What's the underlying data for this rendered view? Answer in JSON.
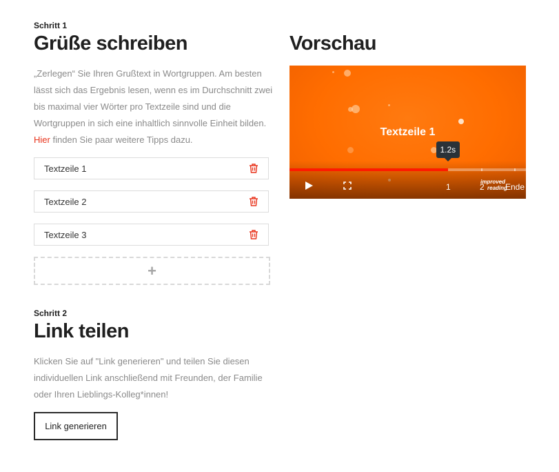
{
  "step1": {
    "label": "Schritt 1",
    "title": "Grüße schreiben",
    "text_before_link": "„Zerlegen“ Sie Ihren Grußtext in Wortgruppen. Am besten lässt sich das Ergebnis lesen, wenn es im Durchschnitt zwei bis maximal vier Wörter pro Textzeile sind und die Wortgruppen in sich eine inhaltlich sinnvolle Einheit bilden.",
    "link_text": "Hier",
    "text_after_link": "finden Sie paar weitere Tipps dazu.",
    "lines": [
      "Textzeile 1",
      "Textzeile 2",
      "Textzeile 3"
    ],
    "add_label": "+"
  },
  "step2": {
    "label": "Schritt 2",
    "title": "Link teilen",
    "text": "Klicken Sie auf \"Link generieren\" und teilen Sie diesen individuellen Link anschließend mit Freunden, der Familie oder Ihren Lieblings-Kolleg*innen!",
    "button_label": "Link generieren"
  },
  "preview": {
    "title": "Vorschau",
    "caption": "Textzeile 1",
    "tooltip": "1.2s",
    "progress_fraction": 0.67,
    "markers": [
      "1",
      "2",
      "Ende"
    ],
    "brand_line1": "improved",
    "brand_line2": "reading",
    "icons": {
      "play": "play-icon",
      "fullscreen": "fullscreen-icon",
      "delete": "trash-icon"
    }
  },
  "colors": {
    "accent": "#e8341c",
    "video_bg": "#ff6d00",
    "progress": "#ff1a00"
  }
}
